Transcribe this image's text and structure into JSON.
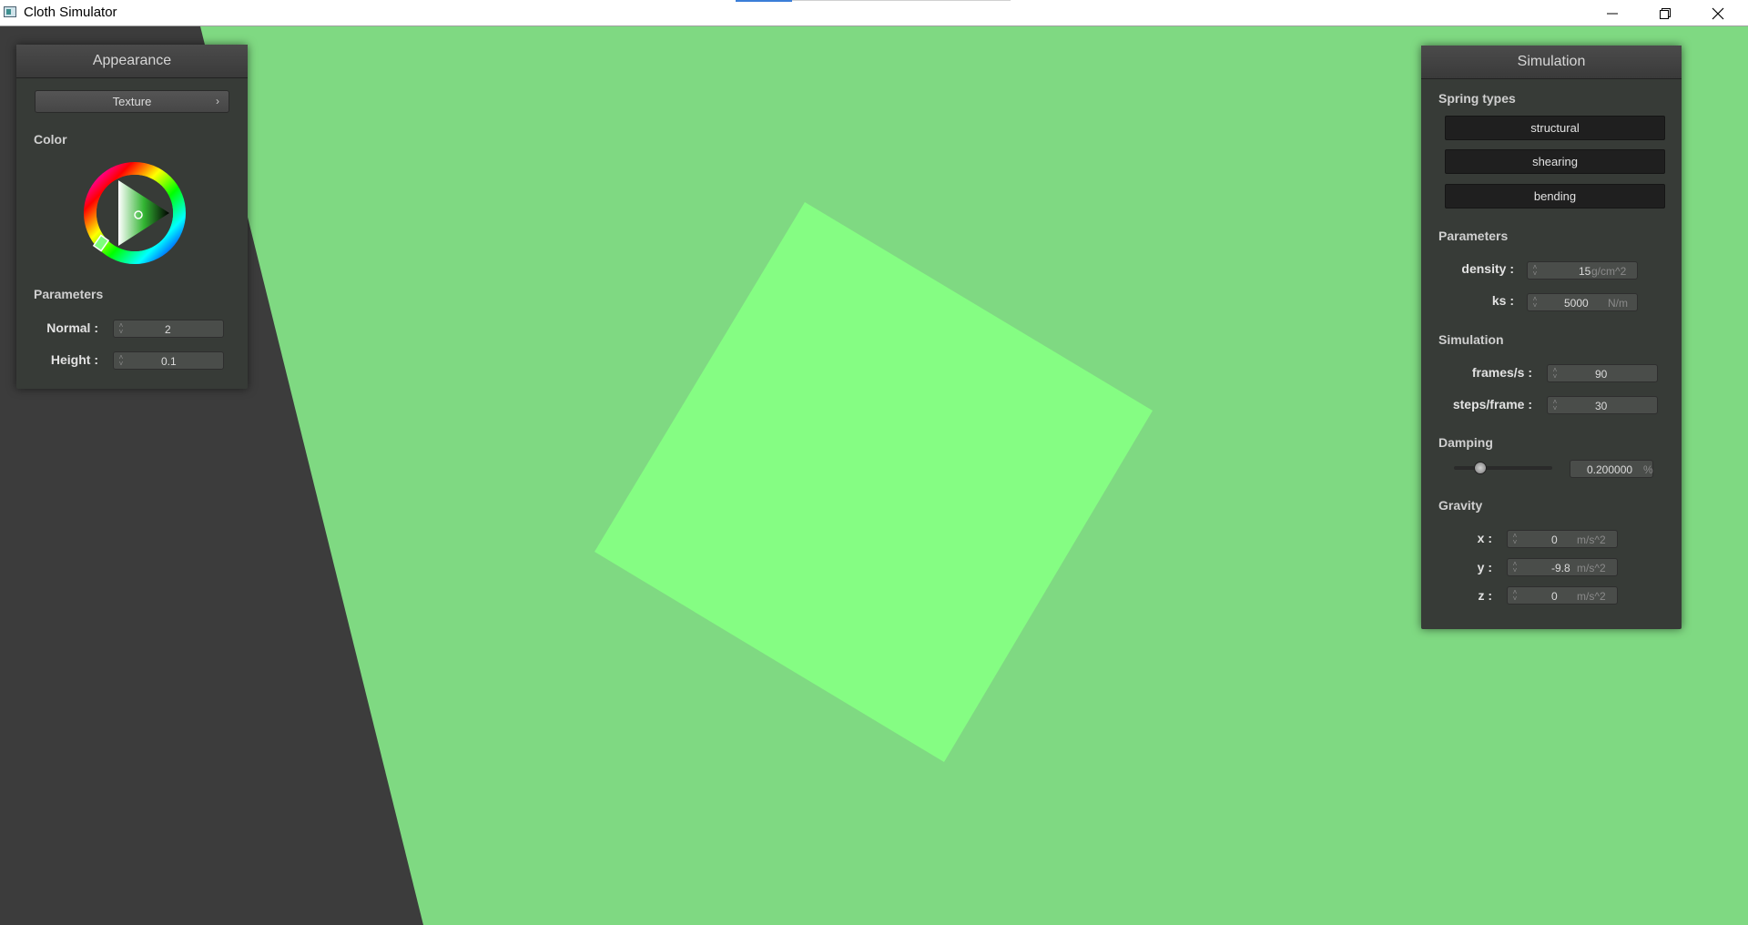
{
  "window": {
    "title": "Cloth Simulator",
    "controls": [
      "minimize",
      "restore",
      "close"
    ]
  },
  "colors": {
    "background": "#7fd982",
    "cloth": "#85fd83",
    "floor": "#3c3c3c",
    "panel": "#373b37"
  },
  "appearance": {
    "title": "Appearance",
    "texture_button": "Texture",
    "color_label": "Color",
    "parameters_label": "Parameters",
    "normal_label": "Normal :",
    "normal_value": "2",
    "height_label": "Height :",
    "height_value": "0.1"
  },
  "simulation_panel": {
    "title": "Simulation",
    "spring_types_label": "Spring types",
    "spring_buttons": [
      "structural",
      "shearing",
      "bending"
    ],
    "parameters_label": "Parameters",
    "density_label": "density :",
    "density_value": "15",
    "density_unit": "g/cm^2",
    "ks_label": "ks :",
    "ks_value": "5000",
    "ks_unit": "N/m",
    "simulation_label": "Simulation",
    "fps_label": "frames/s :",
    "fps_value": "90",
    "steps_label": "steps/frame :",
    "steps_value": "30",
    "damping_label": "Damping",
    "damping_value": "0.200000",
    "damping_unit": "%",
    "damping_level": 0.2,
    "gravity_label": "Gravity",
    "gx_label": "x :",
    "gx_value": "0",
    "gy_label": "y :",
    "gy_value": "-9.8",
    "gz_label": "z :",
    "gz_value": "0",
    "gravity_unit": "m/s^2"
  }
}
